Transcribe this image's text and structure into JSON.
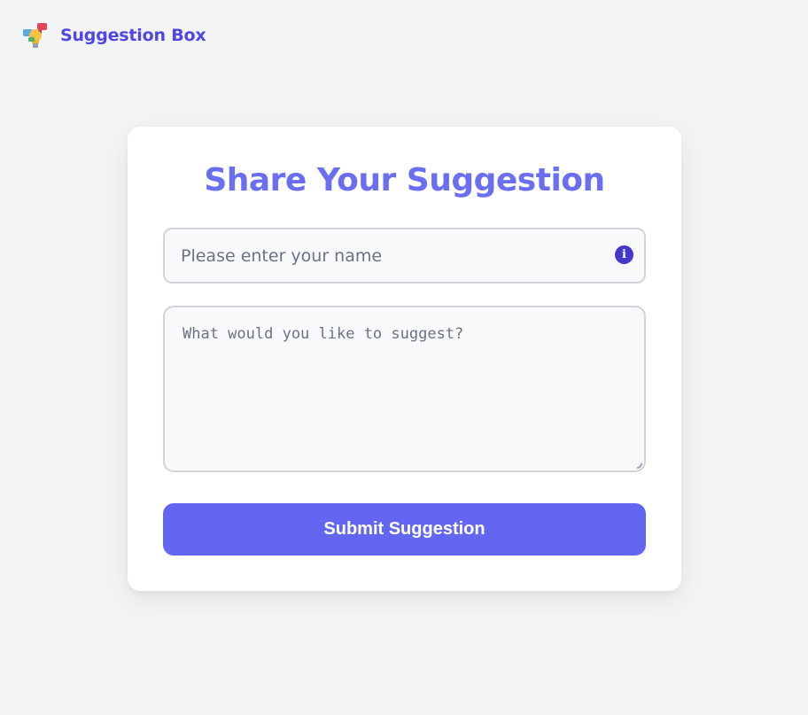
{
  "header": {
    "logo_icon": "lightbulb-speech-bubbles-icon",
    "brand": "Suggestion Box"
  },
  "form": {
    "title": "Share Your Suggestion",
    "name_placeholder": "Please enter your name",
    "name_value": "",
    "info_icon": "info-icon",
    "info_glyph": "i",
    "suggestion_placeholder": "What would you like to suggest?",
    "suggestion_value": "",
    "submit_label": "Submit Suggestion"
  },
  "colors": {
    "brand": "#4f46e5",
    "title": "#6b6ef0",
    "button": "#6366f1",
    "background": "#f3f4f6",
    "card": "#ffffff"
  }
}
